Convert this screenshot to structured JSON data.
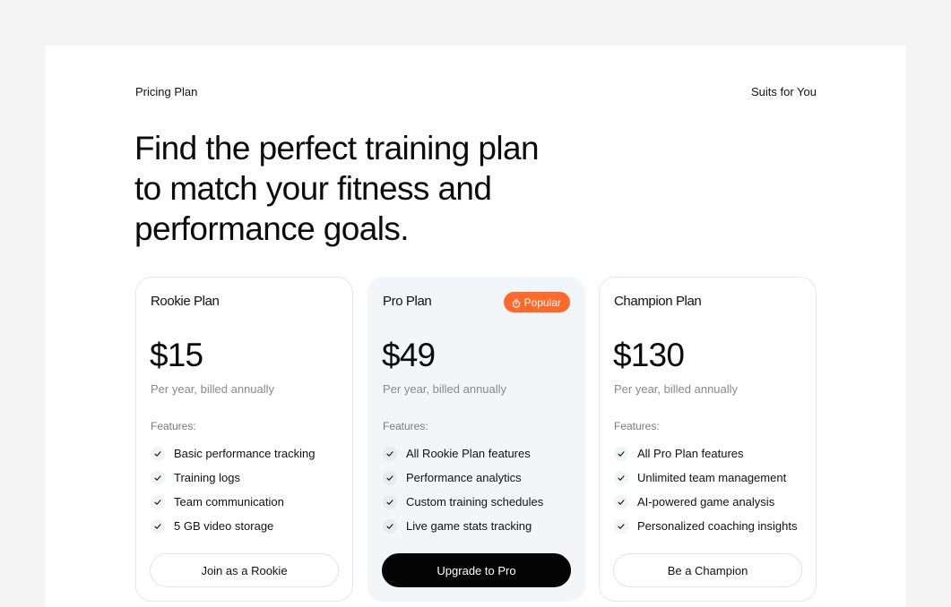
{
  "header": {
    "eyebrow_left": "Pricing Plan",
    "eyebrow_right": "Suits for You",
    "headline": "Find the perfect training plan to match your fitness and performance goals."
  },
  "features_label": "Features:",
  "plans": [
    {
      "name": "Rookie Plan",
      "price": "$15",
      "billing": "Per year, billed annually",
      "features": [
        "Basic performance tracking",
        "Training logs",
        "Team communication",
        "5 GB video storage"
      ],
      "cta": "Join as a Rookie"
    },
    {
      "name": "Pro Plan",
      "badge": "Popular",
      "price": "$49",
      "billing": "Per year, billed annually",
      "features": [
        "All Rookie Plan features",
        "Performance analytics",
        "Custom training schedules",
        "Live game stats tracking"
      ],
      "cta": "Upgrade to Pro"
    },
    {
      "name": "Champion Plan",
      "price": "$130",
      "billing": "Per year, billed annually",
      "features": [
        "All Pro Plan features",
        "Unlimited team management",
        "AI-powered game analysis",
        "Personalized coaching insights"
      ],
      "cta": "Be a Champion"
    }
  ],
  "icons": {
    "check": "check-icon",
    "badge": "stopwatch-icon"
  },
  "colors": {
    "accent": "#ff6a2b",
    "featured_card_bg": "#f3f6f9",
    "primary_button": "#050505"
  }
}
